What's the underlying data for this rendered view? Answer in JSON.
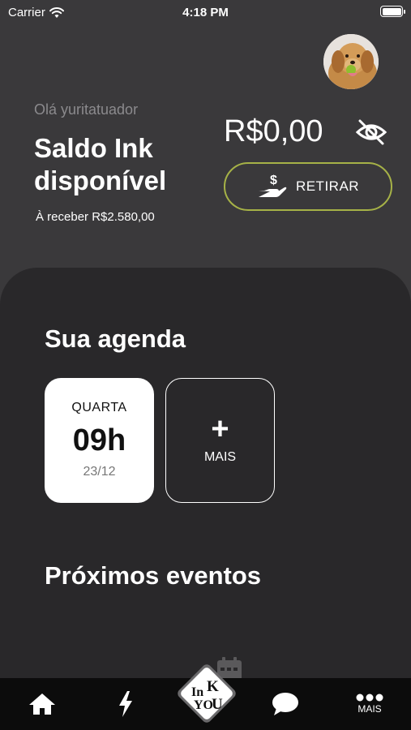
{
  "status_bar": {
    "carrier": "Carrier",
    "time": "4:18 PM",
    "battery_level": 1.0
  },
  "header": {
    "greeting": "Olá yuritatuador",
    "balance_title": "Saldo Ink disponível",
    "to_receive": "À receber R$2.580,00",
    "balance_amount": "R$0,00",
    "visibility_icon": "eye-slash-icon",
    "withdraw_label": "RETIRAR",
    "withdraw_icon": "hand-money-icon",
    "accent_color": "#a6b247"
  },
  "agenda": {
    "title": "Sua agenda",
    "cards": [
      {
        "day": "QUARTA",
        "hour": "09h",
        "date": "23/12"
      }
    ],
    "more_label": "MAIS"
  },
  "events": {
    "title": "Próximos eventos"
  },
  "tab_bar": {
    "items": [
      {
        "icon": "home-icon"
      },
      {
        "icon": "lightning-icon"
      },
      {
        "icon": "ink-you-logo"
      },
      {
        "icon": "chat-bubble-icon"
      },
      {
        "icon": "more-dots-icon",
        "label": "MAIS"
      }
    ],
    "logo_text": [
      "In",
      "K",
      "YO",
      "U"
    ]
  }
}
